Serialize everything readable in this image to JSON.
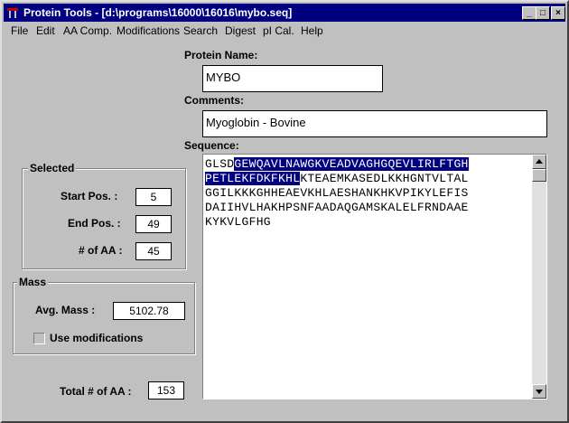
{
  "window": {
    "title": "Protein Tools - [d:\\programs\\16000\\16016\\mybo.seq]",
    "minimize_glyph": "_",
    "maximize_glyph": "□",
    "close_glyph": "×"
  },
  "menu": {
    "file": "File",
    "edit": "Edit",
    "aa_comp": "AA Comp.",
    "modifications": "Modifications",
    "search": "Search",
    "digest": "Digest",
    "pi_cal": "pI Cal.",
    "help": "Help"
  },
  "protein": {
    "name_label": "Protein Name:",
    "name_value": "MYBO",
    "comments_label": "Comments:",
    "comments_value": "Myoglobin - Bovine",
    "sequence_label": "Sequence:",
    "sequence_lines": [
      {
        "pre": "GLSD",
        "sel": "GEWQAVLNAWGKVEADVAGHGQEVLIRLFTGH",
        "post": ""
      },
      {
        "pre": "",
        "sel": "PETLEKFDKFKHL",
        "post": "KTEAEMKASEDLKKHGNTVLTAL"
      },
      {
        "pre": "GGILKKKGHHEAEVKHLAESHANKHKVPIKYLEFIS",
        "sel": "",
        "post": ""
      },
      {
        "pre": "DAIIHVLHAKHPSNFAADAQGAMSKALELFRNDAAE",
        "sel": "",
        "post": ""
      },
      {
        "pre": "KYKVLGFHG",
        "sel": "",
        "post": ""
      }
    ]
  },
  "selected": {
    "title": "Selected",
    "start_label": "Start Pos. :",
    "start_value": "5",
    "end_label": "End Pos. :",
    "end_value": "49",
    "count_label": "# of AA :",
    "count_value": "45"
  },
  "mass": {
    "title": "Mass",
    "avg_label": "Avg. Mass :",
    "avg_value": "5102.78",
    "use_mod_label": "Use modifications"
  },
  "total": {
    "label": "Total # of AA :",
    "value": "153"
  },
  "colors": {
    "titlebar": "#000080",
    "selection": "#000080",
    "face": "#c0c0c0"
  }
}
